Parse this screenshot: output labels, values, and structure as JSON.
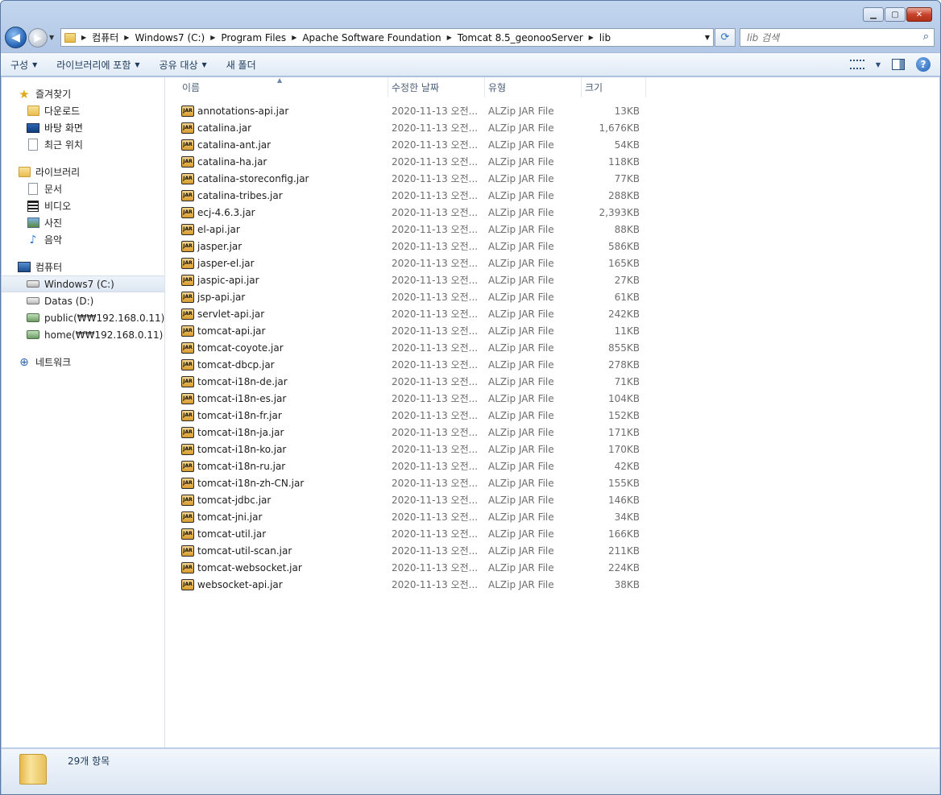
{
  "window": {
    "controls": {
      "minimize": "▁",
      "maximize": "▢",
      "close": "✕"
    }
  },
  "nav_buttons": {
    "back": "◀",
    "forward": "▶"
  },
  "address": {
    "segments": [
      "컴퓨터",
      "Windows7 (C:)",
      "Program Files",
      "Apache Software Foundation",
      "Tomcat 8.5_geonooServer",
      "lib"
    ]
  },
  "search": {
    "placeholder": "lib 검색"
  },
  "toolbar": {
    "organize": "구성",
    "include_library": "라이브러리에 포함",
    "share_with": "공유 대상",
    "new_folder": "새 폴더"
  },
  "sidebar": {
    "favorites": {
      "label": "즐겨찾기",
      "items": [
        "다운로드",
        "바탕 화면",
        "최근 위치"
      ]
    },
    "libraries": {
      "label": "라이브러리",
      "items": [
        "문서",
        "비디오",
        "사진",
        "음악"
      ]
    },
    "computer": {
      "label": "컴퓨터",
      "items": [
        "Windows7 (C:)",
        "Datas (D:)",
        "public(₩₩192.168.0.11) (Y:)",
        "home(₩₩192.168.0.11) (Z:)"
      ]
    },
    "network": {
      "label": "네트워크"
    }
  },
  "columns": {
    "name": "이름",
    "date": "수정한 날짜",
    "type": "유형",
    "size": "크기"
  },
  "files": [
    {
      "name": "annotations-api.jar",
      "date": "2020-11-13 오전...",
      "type": "ALZip JAR File",
      "size": "13KB"
    },
    {
      "name": "catalina.jar",
      "date": "2020-11-13 오전...",
      "type": "ALZip JAR File",
      "size": "1,676KB"
    },
    {
      "name": "catalina-ant.jar",
      "date": "2020-11-13 오전...",
      "type": "ALZip JAR File",
      "size": "54KB"
    },
    {
      "name": "catalina-ha.jar",
      "date": "2020-11-13 오전...",
      "type": "ALZip JAR File",
      "size": "118KB"
    },
    {
      "name": "catalina-storeconfig.jar",
      "date": "2020-11-13 오전...",
      "type": "ALZip JAR File",
      "size": "77KB"
    },
    {
      "name": "catalina-tribes.jar",
      "date": "2020-11-13 오전...",
      "type": "ALZip JAR File",
      "size": "288KB"
    },
    {
      "name": "ecj-4.6.3.jar",
      "date": "2020-11-13 오전...",
      "type": "ALZip JAR File",
      "size": "2,393KB"
    },
    {
      "name": "el-api.jar",
      "date": "2020-11-13 오전...",
      "type": "ALZip JAR File",
      "size": "88KB"
    },
    {
      "name": "jasper.jar",
      "date": "2020-11-13 오전...",
      "type": "ALZip JAR File",
      "size": "586KB"
    },
    {
      "name": "jasper-el.jar",
      "date": "2020-11-13 오전...",
      "type": "ALZip JAR File",
      "size": "165KB"
    },
    {
      "name": "jaspic-api.jar",
      "date": "2020-11-13 오전...",
      "type": "ALZip JAR File",
      "size": "27KB"
    },
    {
      "name": "jsp-api.jar",
      "date": "2020-11-13 오전...",
      "type": "ALZip JAR File",
      "size": "61KB"
    },
    {
      "name": "servlet-api.jar",
      "date": "2020-11-13 오전...",
      "type": "ALZip JAR File",
      "size": "242KB"
    },
    {
      "name": "tomcat-api.jar",
      "date": "2020-11-13 오전...",
      "type": "ALZip JAR File",
      "size": "11KB"
    },
    {
      "name": "tomcat-coyote.jar",
      "date": "2020-11-13 오전...",
      "type": "ALZip JAR File",
      "size": "855KB"
    },
    {
      "name": "tomcat-dbcp.jar",
      "date": "2020-11-13 오전...",
      "type": "ALZip JAR File",
      "size": "278KB"
    },
    {
      "name": "tomcat-i18n-de.jar",
      "date": "2020-11-13 오전...",
      "type": "ALZip JAR File",
      "size": "71KB"
    },
    {
      "name": "tomcat-i18n-es.jar",
      "date": "2020-11-13 오전...",
      "type": "ALZip JAR File",
      "size": "104KB"
    },
    {
      "name": "tomcat-i18n-fr.jar",
      "date": "2020-11-13 오전...",
      "type": "ALZip JAR File",
      "size": "152KB"
    },
    {
      "name": "tomcat-i18n-ja.jar",
      "date": "2020-11-13 오전...",
      "type": "ALZip JAR File",
      "size": "171KB"
    },
    {
      "name": "tomcat-i18n-ko.jar",
      "date": "2020-11-13 오전...",
      "type": "ALZip JAR File",
      "size": "170KB"
    },
    {
      "name": "tomcat-i18n-ru.jar",
      "date": "2020-11-13 오전...",
      "type": "ALZip JAR File",
      "size": "42KB"
    },
    {
      "name": "tomcat-i18n-zh-CN.jar",
      "date": "2020-11-13 오전...",
      "type": "ALZip JAR File",
      "size": "155KB"
    },
    {
      "name": "tomcat-jdbc.jar",
      "date": "2020-11-13 오전...",
      "type": "ALZip JAR File",
      "size": "146KB"
    },
    {
      "name": "tomcat-jni.jar",
      "date": "2020-11-13 오전...",
      "type": "ALZip JAR File",
      "size": "34KB"
    },
    {
      "name": "tomcat-util.jar",
      "date": "2020-11-13 오전...",
      "type": "ALZip JAR File",
      "size": "166KB"
    },
    {
      "name": "tomcat-util-scan.jar",
      "date": "2020-11-13 오전...",
      "type": "ALZip JAR File",
      "size": "211KB"
    },
    {
      "name": "tomcat-websocket.jar",
      "date": "2020-11-13 오전...",
      "type": "ALZip JAR File",
      "size": "224KB"
    },
    {
      "name": "websocket-api.jar",
      "date": "2020-11-13 오전...",
      "type": "ALZip JAR File",
      "size": "38KB"
    }
  ],
  "file_icon_text": "JAR",
  "status": {
    "count": "29개 항목"
  },
  "colors": {
    "accent": "#1e395b",
    "toolbar": "#dfe9f5",
    "frame": "#b2c8e6"
  }
}
